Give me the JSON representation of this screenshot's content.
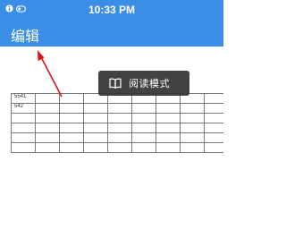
{
  "status_bar": {
    "time": "10:33 PM",
    "icons": [
      "info-icon",
      "orientation-lock-icon"
    ]
  },
  "nav_bar": {
    "title": "编辑"
  },
  "table": {
    "cells": [
      {
        "row": 0,
        "col": 0,
        "text": "5541"
      },
      {
        "row": 1,
        "col": 0,
        "text": "542"
      }
    ]
  },
  "toast": {
    "icon": "book-icon",
    "label": "阅读模式"
  },
  "annotation": {
    "color": "#d9151a"
  },
  "colors": {
    "accent": "#3a8ee6"
  }
}
